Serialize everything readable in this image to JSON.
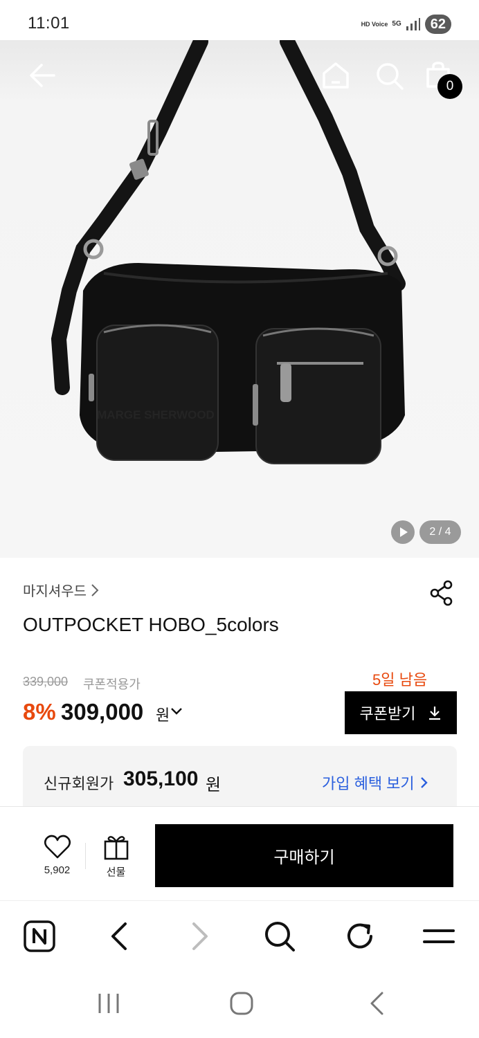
{
  "status_bar": {
    "time": "11:01",
    "hd_voice": "HD Voice",
    "network": "5G",
    "battery": "62"
  },
  "header": {
    "cart_count": "0",
    "icons": [
      "back-arrow-icon",
      "home-icon",
      "search-icon",
      "shopping-bag-icon"
    ]
  },
  "gallery": {
    "counter": "2 / 4",
    "image_brand_text": "MARGE SHERWOOD"
  },
  "product": {
    "brand": "마지셔우드",
    "name": "OUTPOCKET HOBO_5colors",
    "original_price": "339,000",
    "coupon_price_label": "쿠폰적용가",
    "discount": "8%",
    "price": "309,000",
    "currency": "원",
    "days_left": "5일 남음",
    "coupon_button": "쿠폰받기"
  },
  "member": {
    "label": "신규회원가",
    "price": "305,100",
    "currency": "원",
    "link": "가입 혜택 보기"
  },
  "purchase_bar": {
    "like_count": "5,902",
    "gift_label": "선물",
    "buy_label": "구매하기"
  },
  "colors": {
    "accent": "#e8490e",
    "link": "#2a5fde",
    "primary_button": "#000000"
  }
}
